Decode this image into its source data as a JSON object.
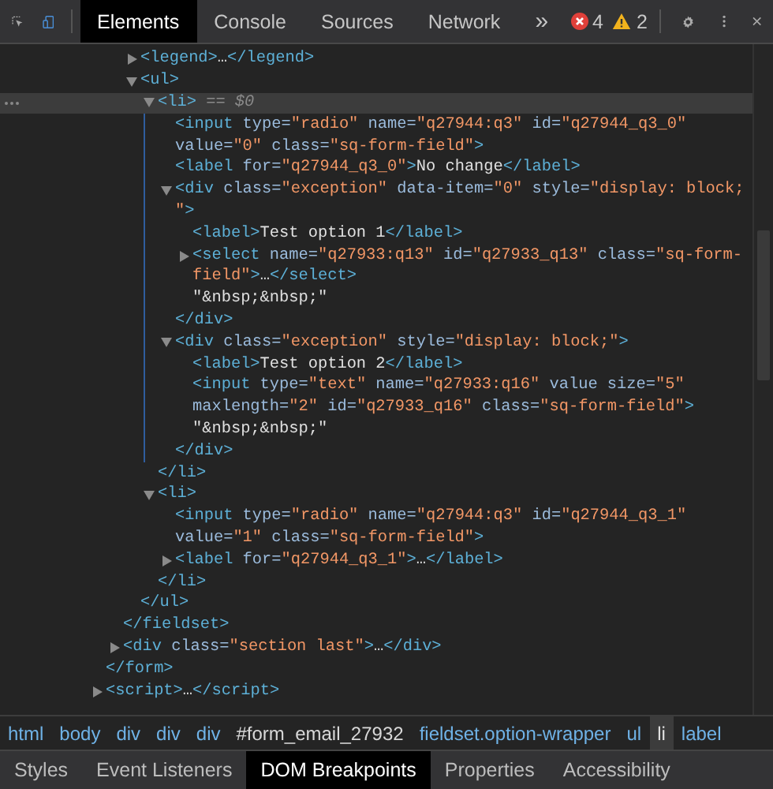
{
  "toolbar": {
    "tabs": [
      {
        "label": "Elements",
        "selected": true
      },
      {
        "label": "Console",
        "selected": false
      },
      {
        "label": "Sources",
        "selected": false
      },
      {
        "label": "Network",
        "selected": false
      }
    ],
    "overflow": "»",
    "errors": "4",
    "warnings": "2"
  },
  "dom_tree": {
    "nodes": [
      {
        "children": [
          {
            "children": [
              {
                "expanded": false,
                "selected": false,
                "lines": [
                  [
                    {
                      "kind": "tag",
                      "text": "<legend>"
                    },
                    {
                      "kind": "text",
                      "text": "…"
                    },
                    {
                      "kind": "tag",
                      "text": "</legend>"
                    }
                  ]
                ]
              },
              {
                "expanded": true,
                "selected": false,
                "lines": [
                  [
                    {
                      "kind": "tag",
                      "text": "<ul>"
                    }
                  ]
                ],
                "children": [
                  {
                    "expanded": true,
                    "selected": true,
                    "lines": [
                      [
                        {
                          "kind": "tag",
                          "text": "<li>"
                        },
                        {
                          "kind": "hint",
                          "text": " == $0"
                        }
                      ]
                    ],
                    "children": [
                      {
                        "selected": false,
                        "lines": [
                          [
                            {
                              "kind": "tag",
                              "text": "<input"
                            },
                            {
                              "kind": "attr",
                              "text": " type="
                            },
                            {
                              "kind": "value",
                              "text": "\"radio\""
                            },
                            {
                              "kind": "attr",
                              "text": " name="
                            },
                            {
                              "kind": "value",
                              "text": "\"q27944:q3\""
                            },
                            {
                              "kind": "attr",
                              "text": " id="
                            },
                            {
                              "kind": "value",
                              "text": "\"q27944_q3_0\""
                            }
                          ],
                          [
                            {
                              "kind": "attr",
                              "text": "value="
                            },
                            {
                              "kind": "value",
                              "text": "\"0\""
                            },
                            {
                              "kind": "attr",
                              "text": " class="
                            },
                            {
                              "kind": "value",
                              "text": "\"sq-form-field\""
                            },
                            {
                              "kind": "tag",
                              "text": ">"
                            }
                          ]
                        ]
                      },
                      {
                        "selected": false,
                        "lines": [
                          [
                            {
                              "kind": "tag",
                              "text": "<label"
                            },
                            {
                              "kind": "attr",
                              "text": " for="
                            },
                            {
                              "kind": "value",
                              "text": "\"q27944_q3_0\""
                            },
                            {
                              "kind": "tag",
                              "text": ">"
                            },
                            {
                              "kind": "text",
                              "text": "No change"
                            },
                            {
                              "kind": "tag",
                              "text": "</label>"
                            }
                          ]
                        ]
                      },
                      {
                        "expanded": true,
                        "selected": false,
                        "lines": [
                          [
                            {
                              "kind": "tag",
                              "text": "<div"
                            },
                            {
                              "kind": "attr",
                              "text": " class="
                            },
                            {
                              "kind": "value",
                              "text": "\"exception\""
                            },
                            {
                              "kind": "attr",
                              "text": " data-item="
                            },
                            {
                              "kind": "value",
                              "text": "\"0\""
                            },
                            {
                              "kind": "attr",
                              "text": " style="
                            },
                            {
                              "kind": "value",
                              "text": "\"display: block;"
                            }
                          ],
                          [
                            {
                              "kind": "value",
                              "text": "\""
                            },
                            {
                              "kind": "tag",
                              "text": ">"
                            }
                          ]
                        ],
                        "children": [
                          {
                            "selected": false,
                            "lines": [
                              [
                                {
                                  "kind": "tag",
                                  "text": "<label>"
                                },
                                {
                                  "kind": "text",
                                  "text": "Test option 1"
                                },
                                {
                                  "kind": "tag",
                                  "text": "</label>"
                                }
                              ]
                            ]
                          },
                          {
                            "expanded": false,
                            "selected": false,
                            "lines": [
                              [
                                {
                                  "kind": "tag",
                                  "text": "<select"
                                },
                                {
                                  "kind": "attr",
                                  "text": " name="
                                },
                                {
                                  "kind": "value",
                                  "text": "\"q27933:q13\""
                                },
                                {
                                  "kind": "attr",
                                  "text": " id="
                                },
                                {
                                  "kind": "value",
                                  "text": "\"q27933_q13\""
                                },
                                {
                                  "kind": "attr",
                                  "text": " class="
                                },
                                {
                                  "kind": "value",
                                  "text": "\"sq-form-"
                                }
                              ],
                              [
                                {
                                  "kind": "value",
                                  "text": "field\""
                                },
                                {
                                  "kind": "tag",
                                  "text": ">"
                                },
                                {
                                  "kind": "text",
                                  "text": "…"
                                },
                                {
                                  "kind": "tag",
                                  "text": "</select>"
                                }
                              ]
                            ]
                          },
                          {
                            "selected": false,
                            "lines": [
                              [
                                {
                                  "kind": "text",
                                  "text": "\"&nbsp;&nbsp;\""
                                }
                              ]
                            ]
                          }
                        ],
                        "closing": [
                          {
                            "kind": "tag",
                            "text": "</div>"
                          }
                        ]
                      },
                      {
                        "expanded": true,
                        "selected": false,
                        "lines": [
                          [
                            {
                              "kind": "tag",
                              "text": "<div"
                            },
                            {
                              "kind": "attr",
                              "text": " class="
                            },
                            {
                              "kind": "value",
                              "text": "\"exception\""
                            },
                            {
                              "kind": "attr",
                              "text": " style="
                            },
                            {
                              "kind": "value",
                              "text": "\"display: block;\""
                            },
                            {
                              "kind": "tag",
                              "text": ">"
                            }
                          ]
                        ],
                        "children": [
                          {
                            "selected": false,
                            "lines": [
                              [
                                {
                                  "kind": "tag",
                                  "text": "<label>"
                                },
                                {
                                  "kind": "text",
                                  "text": "Test option 2"
                                },
                                {
                                  "kind": "tag",
                                  "text": "</label>"
                                }
                              ]
                            ]
                          },
                          {
                            "selected": false,
                            "lines": [
                              [
                                {
                                  "kind": "tag",
                                  "text": "<input"
                                },
                                {
                                  "kind": "attr",
                                  "text": " type="
                                },
                                {
                                  "kind": "value",
                                  "text": "\"text\""
                                },
                                {
                                  "kind": "attr",
                                  "text": " name="
                                },
                                {
                                  "kind": "value",
                                  "text": "\"q27933:q16\""
                                },
                                {
                                  "kind": "attr",
                                  "text": " value size="
                                },
                                {
                                  "kind": "value",
                                  "text": "\"5\""
                                }
                              ],
                              [
                                {
                                  "kind": "attr",
                                  "text": "maxlength="
                                },
                                {
                                  "kind": "value",
                                  "text": "\"2\""
                                },
                                {
                                  "kind": "attr",
                                  "text": " id="
                                },
                                {
                                  "kind": "value",
                                  "text": "\"q27933_q16\""
                                },
                                {
                                  "kind": "attr",
                                  "text": " class="
                                },
                                {
                                  "kind": "value",
                                  "text": "\"sq-form-field\""
                                },
                                {
                                  "kind": "tag",
                                  "text": ">"
                                }
                              ]
                            ]
                          },
                          {
                            "selected": false,
                            "lines": [
                              [
                                {
                                  "kind": "text",
                                  "text": "\"&nbsp;&nbsp;\""
                                }
                              ]
                            ]
                          }
                        ],
                        "closing": [
                          {
                            "kind": "tag",
                            "text": "</div>"
                          }
                        ]
                      }
                    ],
                    "closing": [
                      {
                        "kind": "tag",
                        "text": "</li>"
                      }
                    ]
                  },
                  {
                    "expanded": true,
                    "selected": false,
                    "lines": [
                      [
                        {
                          "kind": "tag",
                          "text": "<li>"
                        }
                      ]
                    ],
                    "children": [
                      {
                        "selected": false,
                        "lines": [
                          [
                            {
                              "kind": "tag",
                              "text": "<input"
                            },
                            {
                              "kind": "attr",
                              "text": " type="
                            },
                            {
                              "kind": "value",
                              "text": "\"radio\""
                            },
                            {
                              "kind": "attr",
                              "text": " name="
                            },
                            {
                              "kind": "value",
                              "text": "\"q27944:q3\""
                            },
                            {
                              "kind": "attr",
                              "text": " id="
                            },
                            {
                              "kind": "value",
                              "text": "\"q27944_q3_1\""
                            }
                          ],
                          [
                            {
                              "kind": "attr",
                              "text": "value="
                            },
                            {
                              "kind": "value",
                              "text": "\"1\""
                            },
                            {
                              "kind": "attr",
                              "text": " class="
                            },
                            {
                              "kind": "value",
                              "text": "\"sq-form-field\""
                            },
                            {
                              "kind": "tag",
                              "text": ">"
                            }
                          ]
                        ]
                      },
                      {
                        "expanded": false,
                        "selected": false,
                        "lines": [
                          [
                            {
                              "kind": "tag",
                              "text": "<label"
                            },
                            {
                              "kind": "attr",
                              "text": " for="
                            },
                            {
                              "kind": "value",
                              "text": "\"q27944_q3_1\""
                            },
                            {
                              "kind": "tag",
                              "text": ">"
                            },
                            {
                              "kind": "text",
                              "text": "…"
                            },
                            {
                              "kind": "tag",
                              "text": "</label>"
                            }
                          ]
                        ]
                      }
                    ],
                    "closing": [
                      {
                        "kind": "tag",
                        "text": "</li>"
                      }
                    ]
                  }
                ],
                "closing": [
                  {
                    "kind": "tag",
                    "text": "</ul>"
                  }
                ]
              }
            ],
            "closing": [
              {
                "kind": "tag",
                "text": "</fieldset>"
              }
            ]
          },
          {
            "expanded": false,
            "selected": false,
            "lines": [
              [
                {
                  "kind": "tag",
                  "text": "<div"
                },
                {
                  "kind": "attr",
                  "text": " class="
                },
                {
                  "kind": "value",
                  "text": "\"section last\""
                },
                {
                  "kind": "tag",
                  "text": ">"
                },
                {
                  "kind": "text",
                  "text": "…"
                },
                {
                  "kind": "tag",
                  "text": "</div>"
                }
              ]
            ]
          }
        ],
        "closing": [
          {
            "kind": "tag",
            "text": "</form>"
          }
        ]
      },
      {
        "expanded": false,
        "selected": false,
        "lines": [
          [
            {
              "kind": "tag",
              "text": "<script>"
            },
            {
              "kind": "text",
              "text": "…"
            },
            {
              "kind": "tag",
              "text": "</script>"
            }
          ]
        ]
      }
    ]
  },
  "breadcrumbs": [
    {
      "label": "html",
      "kind": "tag",
      "selected": false
    },
    {
      "label": "body",
      "kind": "tag",
      "selected": false
    },
    {
      "label": "div",
      "kind": "tag",
      "selected": false
    },
    {
      "label": "div",
      "kind": "tag",
      "selected": false
    },
    {
      "label": "div",
      "kind": "tag",
      "selected": false
    },
    {
      "label": "#form_email_27932",
      "kind": "id",
      "selected": false
    },
    {
      "label": "fieldset.option-wrapper",
      "kind": "tag",
      "selected": false
    },
    {
      "label": "ul",
      "kind": "tag",
      "selected": false
    },
    {
      "label": "li",
      "kind": "tag",
      "selected": true
    },
    {
      "label": "label",
      "kind": "tag",
      "selected": false
    }
  ],
  "panel_tabs": [
    {
      "label": "Styles",
      "selected": false
    },
    {
      "label": "Event Listeners",
      "selected": false
    },
    {
      "label": "DOM Breakpoints",
      "selected": true
    },
    {
      "label": "Properties",
      "selected": false
    },
    {
      "label": "Accessibility",
      "selected": false
    }
  ]
}
